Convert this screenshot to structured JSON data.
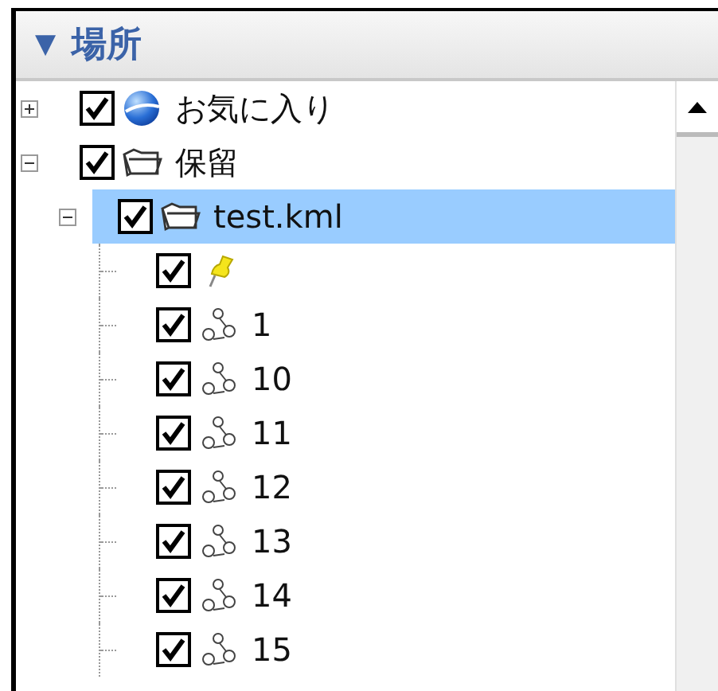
{
  "panel": {
    "toggle": "▼",
    "title": "場所"
  },
  "tree": [
    {
      "label": "お気に入り",
      "kind": "earth",
      "checked": true,
      "expanded": false,
      "selected": false
    },
    {
      "label": "保留",
      "kind": "folder",
      "checked": true,
      "expanded": true,
      "selected": false,
      "children": [
        {
          "label": "test.kml",
          "kind": "folder",
          "checked": true,
          "expanded": true,
          "selected": true,
          "children": [
            {
              "kind": "pin",
              "checked": true,
              "selected": false
            },
            {
              "label": "1",
              "kind": "path",
              "checked": true,
              "selected": false
            },
            {
              "label": "10",
              "kind": "path",
              "checked": true,
              "selected": false
            },
            {
              "label": "11",
              "kind": "path",
              "checked": true,
              "selected": false
            },
            {
              "label": "12",
              "kind": "path",
              "checked": true,
              "selected": false
            },
            {
              "label": "13",
              "kind": "path",
              "checked": true,
              "selected": false
            },
            {
              "label": "14",
              "kind": "path",
              "checked": true,
              "selected": false
            },
            {
              "label": "15",
              "kind": "path",
              "checked": true,
              "selected": false
            }
          ]
        }
      ]
    }
  ]
}
